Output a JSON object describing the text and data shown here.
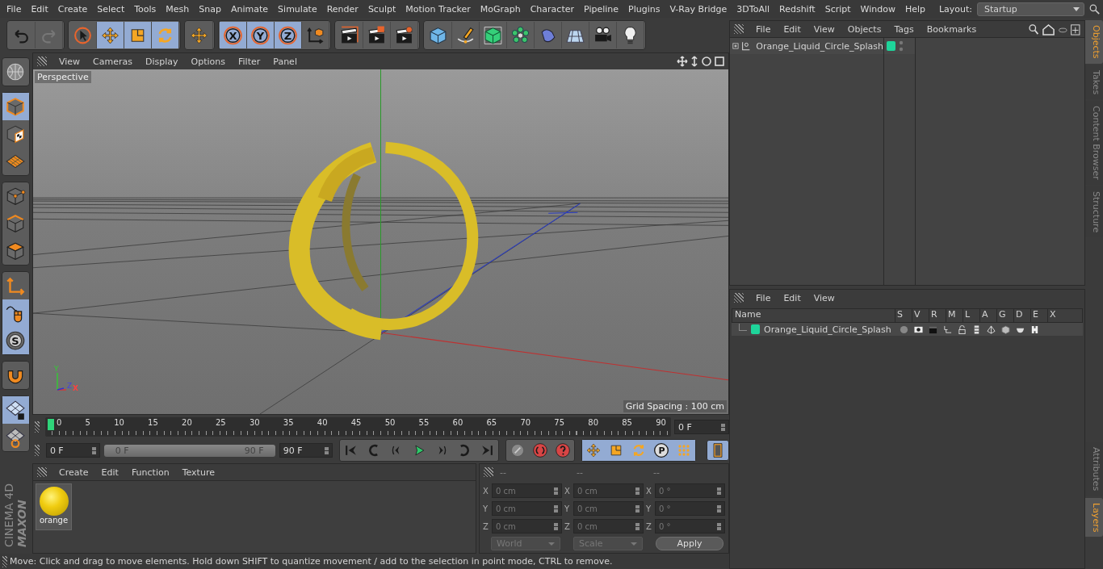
{
  "menubar": {
    "menus": [
      "File",
      "Edit",
      "Create",
      "Select",
      "Tools",
      "Mesh",
      "Snap",
      "Animate",
      "Simulate",
      "Render",
      "Sculpt",
      "Motion Tracker",
      "MoGraph",
      "Character",
      "Pipeline",
      "Plugins",
      "V-Ray Bridge",
      "3DToAll",
      "Redshift",
      "Script",
      "Window",
      "Help"
    ],
    "layout_label": "Layout:",
    "layout_value": "Startup"
  },
  "toolbar": {
    "groups": [
      [
        {
          "kind": "undo",
          "selected": false
        },
        {
          "kind": "redo",
          "selected": false
        }
      ],
      [
        {
          "kind": "select",
          "selected": false
        },
        {
          "kind": "move",
          "selected": true
        },
        {
          "kind": "scale",
          "selected": true
        },
        {
          "kind": "rotate",
          "selected": true
        }
      ],
      [
        {
          "kind": "move",
          "selected": false
        }
      ],
      [
        {
          "kind": "axis",
          "label": "X",
          "selected": true
        },
        {
          "kind": "axis",
          "label": "Y",
          "selected": true
        },
        {
          "kind": "axis",
          "label": "Z",
          "selected": true
        },
        {
          "kind": "coord",
          "selected": false
        }
      ],
      [
        {
          "kind": "render-view",
          "selected": false
        },
        {
          "kind": "render",
          "selected": false
        },
        {
          "kind": "render-settings",
          "selected": false
        }
      ],
      [
        {
          "kind": "cube",
          "selected": false
        },
        {
          "kind": "pen",
          "selected": false
        },
        {
          "kind": "subdiv",
          "selected": false
        },
        {
          "kind": "cloner",
          "selected": false
        },
        {
          "kind": "deformer",
          "selected": false
        },
        {
          "kind": "floor",
          "selected": false
        },
        {
          "kind": "camera",
          "selected": false
        },
        {
          "kind": "light",
          "selected": false
        }
      ]
    ]
  },
  "tool_strip": {
    "groups": [
      [
        {
          "kind": "globe",
          "selected": false
        }
      ],
      [
        {
          "kind": "model",
          "selected": true
        },
        {
          "kind": "texture",
          "selected": false
        },
        {
          "kind": "workplane",
          "selected": false
        }
      ],
      [
        {
          "kind": "points",
          "selected": false
        },
        {
          "kind": "edges",
          "selected": false
        },
        {
          "kind": "polygons",
          "selected": false
        }
      ],
      [
        {
          "kind": "axis-tool",
          "selected": false
        },
        {
          "kind": "tweak",
          "selected": true
        },
        {
          "kind": "snap",
          "label": "S",
          "selected": true
        }
      ],
      [
        {
          "kind": "magnet",
          "selected": false
        }
      ],
      [
        {
          "kind": "lock-grid",
          "selected": true
        },
        {
          "kind": "grid-rotate",
          "selected": false
        }
      ]
    ]
  },
  "viewport": {
    "menus": [
      "View",
      "Cameras",
      "Display",
      "Options",
      "Filter",
      "Panel"
    ],
    "camera": "Perspective",
    "axis_labels": [
      "Y",
      "Z",
      "X"
    ],
    "grid_info": "Grid Spacing : 100 cm"
  },
  "timeline": {
    "ticks": [
      "0",
      "5",
      "10",
      "15",
      "20",
      "25",
      "30",
      "35",
      "40",
      "45",
      "50",
      "55",
      "60",
      "65",
      "70",
      "75",
      "80",
      "85",
      "90"
    ],
    "playhead": {
      "level": 0
    },
    "current_frame": "0 F",
    "start": "0 F",
    "range": {
      "level": 1
    },
    "range_start": "0 F",
    "range_end": "90 F",
    "end": "90 F",
    "transport": [
      {
        "kind": "first"
      },
      {
        "kind": "prev-key"
      },
      {
        "kind": "prev-frame"
      },
      {
        "kind": "play"
      },
      {
        "kind": "next-frame"
      },
      {
        "kind": "next-key"
      },
      {
        "kind": "last"
      }
    ],
    "keys": [
      {
        "kind": "key-off"
      },
      {
        "kind": "record"
      },
      {
        "kind": "autokey"
      }
    ],
    "tracks": [
      {
        "kind": "move",
        "selected": true
      },
      {
        "kind": "scale",
        "selected": true
      },
      {
        "kind": "rotate",
        "selected": true
      },
      {
        "kind": "param",
        "label": "P",
        "selected": true
      },
      {
        "kind": "pla",
        "selected": true
      }
    ]
  },
  "materials": {
    "menus": [
      "Create",
      "Edit",
      "Function",
      "Texture"
    ],
    "items": [
      {
        "name": "orange"
      }
    ]
  },
  "coordinates": {
    "headers": [
      "--",
      "--",
      "--"
    ],
    "rows": [
      {
        "cells": [
          {
            "label": "X",
            "value": "0 cm"
          },
          {
            "label": "X",
            "value": "0 cm"
          },
          {
            "label": "X",
            "value": "0 °"
          }
        ]
      },
      {
        "cells": [
          {
            "label": "Y",
            "value": "0 cm"
          },
          {
            "label": "Y",
            "value": "0 cm"
          },
          {
            "label": "Y",
            "value": "0 °"
          }
        ]
      },
      {
        "cells": [
          {
            "label": "Z",
            "value": "0 cm"
          },
          {
            "label": "Z",
            "value": "0 cm"
          },
          {
            "label": "Z",
            "value": "0 °"
          }
        ]
      }
    ],
    "mode": "World",
    "scale": "Scale",
    "apply": "Apply"
  },
  "logo": {
    "brand": "MAXON",
    "product": "CINEMA 4D"
  },
  "status_bar": "Move: Click and drag to move elements. Hold down SHIFT to quantize movement / add to the selection in point mode, CTRL to remove.",
  "object_manager": {
    "menus": [
      "File",
      "Edit",
      "View",
      "Objects",
      "Tags",
      "Bookmarks"
    ],
    "objects": [
      {
        "name": "Orange_Liquid_Circle_Splash",
        "color": "#1ed49a"
      }
    ]
  },
  "layer_manager": {
    "menus": [
      "File",
      "Edit",
      "View"
    ],
    "columns": [
      "Name",
      "S",
      "V",
      "R",
      "M",
      "L",
      "A",
      "G",
      "D",
      "E",
      "X"
    ],
    "layers": [
      {
        "name": "Orange_Liquid_Circle_Splash",
        "color": "#1ed49a"
      }
    ]
  },
  "side_tabs_top": [
    {
      "label": "Objects",
      "selected": true
    },
    {
      "label": "Takes",
      "selected": false
    },
    {
      "label": "Content Browser",
      "selected": false
    },
    {
      "label": "Structure",
      "selected": false
    }
  ],
  "side_tabs_bottom": [
    {
      "label": "Attributes",
      "selected": false
    },
    {
      "label": "Layers",
      "selected": true
    }
  ]
}
